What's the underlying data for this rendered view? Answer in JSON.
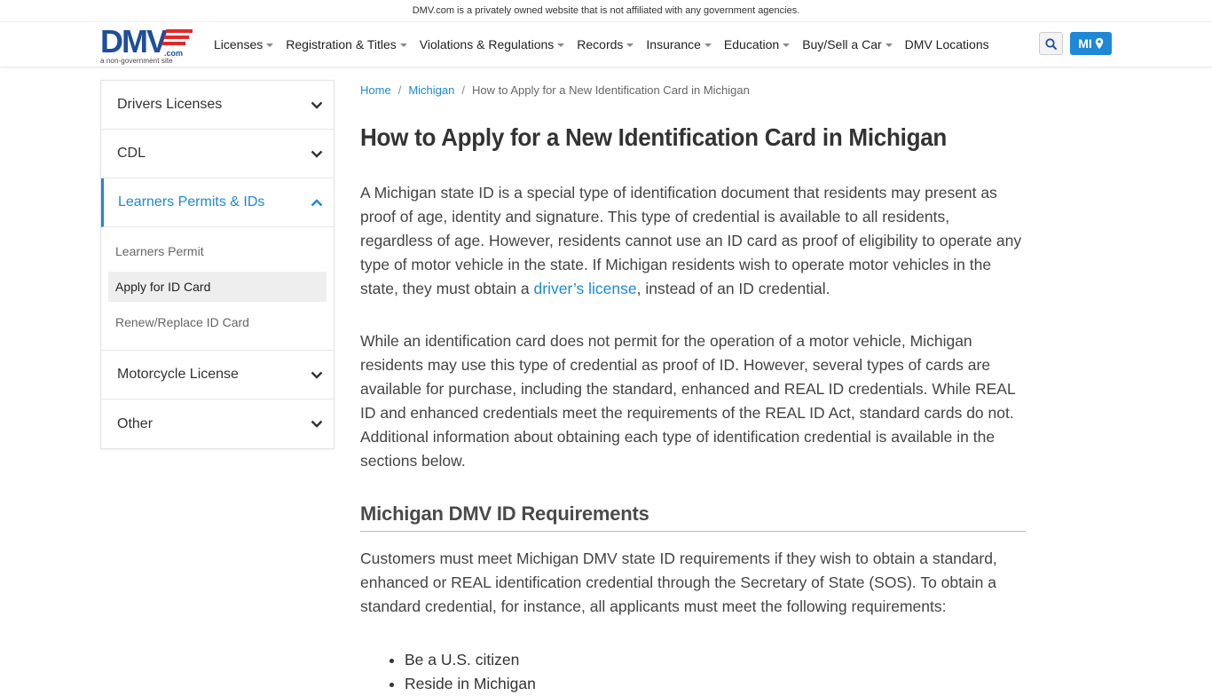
{
  "topbar": {
    "notice": "DMV.com is a privately owned website that is not affiliated with any government agencies."
  },
  "logo": {
    "text": "DMV",
    "tld": ".com",
    "subtitle": "a non-government site",
    "brand_color": "#1f4e9a",
    "accent_color": "#e02929"
  },
  "nav": {
    "items": [
      {
        "label": "Licenses",
        "dropdown": true
      },
      {
        "label": "Registration & Titles",
        "dropdown": true
      },
      {
        "label": "Violations & Regulations",
        "dropdown": true
      },
      {
        "label": "Records",
        "dropdown": true
      },
      {
        "label": "Insurance",
        "dropdown": true
      },
      {
        "label": "Education",
        "dropdown": true
      },
      {
        "label": "Buy/Sell a Car",
        "dropdown": true
      },
      {
        "label": "DMV Locations",
        "dropdown": false
      }
    ],
    "search_icon": "search-icon",
    "state_label": "MI",
    "state_icon": "map-pin-icon",
    "accent": "#1e88d6"
  },
  "sidebar": {
    "sections": [
      {
        "label": "Drivers Licenses",
        "expanded": false
      },
      {
        "label": "CDL",
        "expanded": false
      },
      {
        "label": "Learners Permits & IDs",
        "expanded": true,
        "links": [
          "Learners Permit",
          "Apply for ID Card",
          "Renew/Replace ID Card"
        ],
        "current": "Apply for ID Card"
      },
      {
        "label": "Motorcycle License",
        "expanded": false
      },
      {
        "label": "Other",
        "expanded": false
      }
    ]
  },
  "breadcrumb": {
    "home": "Home",
    "state": "Michigan",
    "current": "How to Apply for a New Identification Card in Michigan",
    "separator": "/"
  },
  "article": {
    "title": "How to Apply for a New Identification Card in Michigan",
    "p1_before": "A Michigan state ID is a special type of identification document that residents may present as proof of age, identity and signature. This type of credential is available to all residents, regardless of age. However, residents cannot use an ID card as proof of eligibility to operate any type of motor vehicle in the state. If Michigan residents wish to operate motor vehicles in the state, they must obtain a ",
    "p1_link": "driver’s license",
    "p1_after": ", instead of an ID credential.",
    "p2": "While an identification card does not permit for the operation of a motor vehicle, Michigan residents may use this type of credential as proof of ID. However, several types of cards are available for purchase, including the standard, enhanced and REAL ID credentials. While REAL ID and enhanced credentials meet the requirements of the REAL ID Act, standard cards do not. Additional information about obtaining each type of identification credential is available in the sections below.",
    "h2": "Michigan DMV ID Requirements",
    "p3": "Customers must meet Michigan DMV state ID requirements if they wish to obtain a standard, enhanced or REAL identification credential through the Secretary of State (SOS). To obtain a standard credential, for instance, all applicants must meet the following requirements:",
    "requirements": [
      "Be a U.S. citizen",
      "Reside in Michigan"
    ]
  }
}
